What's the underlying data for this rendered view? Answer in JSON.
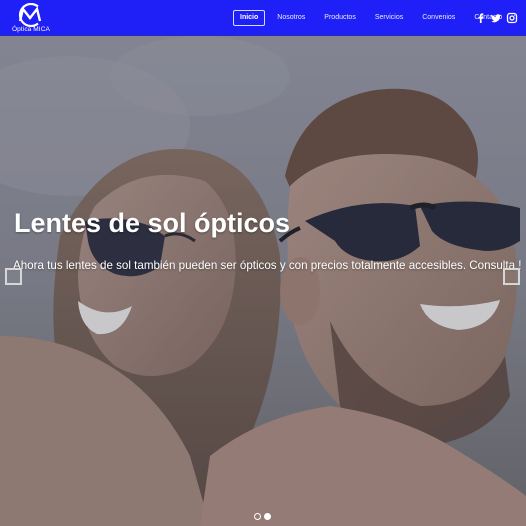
{
  "brand": {
    "logo_letters": "MC",
    "name": "Óptica MICA"
  },
  "nav": {
    "items": [
      {
        "label": "Inicio",
        "active": true
      },
      {
        "label": "Nosotros",
        "active": false
      },
      {
        "label": "Productos",
        "active": false
      },
      {
        "label": "Servicios",
        "active": false
      },
      {
        "label": "Convenios",
        "active": false
      },
      {
        "label": "Contacto",
        "active": false
      }
    ],
    "social": [
      "facebook-icon",
      "twitter-icon",
      "instagram-icon"
    ]
  },
  "hero": {
    "title": "Lentes de sol ópticos",
    "subtitle": "Ahora tus lentes de sol también pueden ser ópticos y con precios totalmente accesibles. Consulta !",
    "slides_total": 2,
    "active_slide": 2
  },
  "colors": {
    "navbar": "#1f1ff7",
    "text": "#ffffff"
  }
}
